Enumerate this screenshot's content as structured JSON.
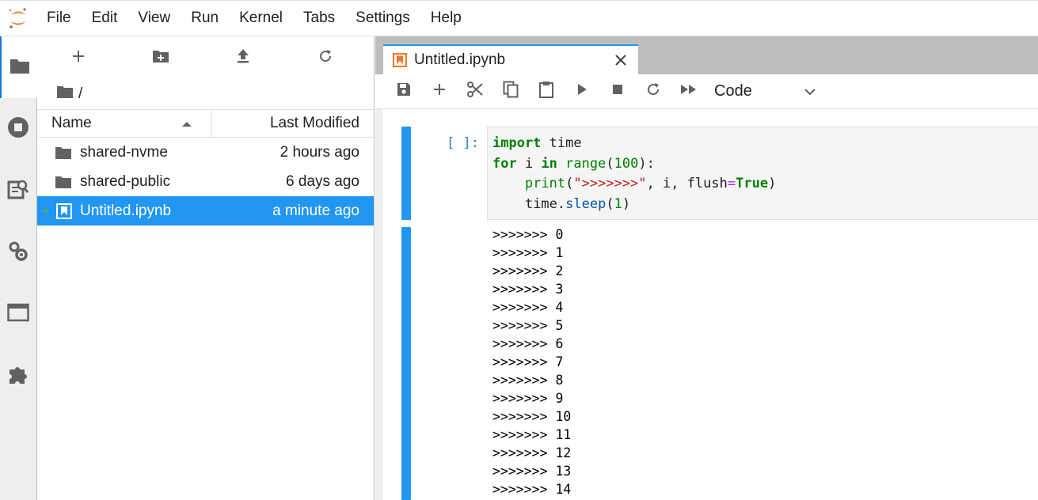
{
  "menubar": {
    "items": [
      "File",
      "Edit",
      "View",
      "Run",
      "Kernel",
      "Tabs",
      "Settings",
      "Help"
    ]
  },
  "leftbar": {
    "icons": [
      "folder-icon",
      "running-icon",
      "command-palette-icon",
      "property-inspector-icon",
      "tabs-icon",
      "extension-icon"
    ]
  },
  "filebrowser": {
    "breadcrumb": "/",
    "col_name": "Name",
    "col_modified": "Last Modified",
    "rows": [
      {
        "name": "shared-nvme",
        "modified": "2 hours ago",
        "type": "folder"
      },
      {
        "name": "shared-public",
        "modified": "6 days ago",
        "type": "folder"
      },
      {
        "name": "Untitled.ipynb",
        "modified": "a minute ago",
        "type": "notebook"
      }
    ]
  },
  "tab": {
    "label": "Untitled.ipynb"
  },
  "notebook_toolbar": {
    "cell_type": "Code"
  },
  "cell": {
    "prompt": "[ ]:",
    "output": [
      ">>>>>>> 0",
      ">>>>>>> 1",
      ">>>>>>> 2",
      ">>>>>>> 3",
      ">>>>>>> 4",
      ">>>>>>> 5",
      ">>>>>>> 6",
      ">>>>>>> 7",
      ">>>>>>> 8",
      ">>>>>>> 9",
      ">>>>>>> 10",
      ">>>>>>> 11",
      ">>>>>>> 12",
      ">>>>>>> 13",
      ">>>>>>> 14"
    ],
    "code": {
      "l1_kw": "import",
      "l1_rest": " time",
      "l2_for": "for",
      "l2_i": " i ",
      "l2_in": "in",
      "l2_sp": " ",
      "l2_range": "range",
      "l2_open": "(",
      "l2_num": "100",
      "l2_close": "):",
      "l3_indent": "    ",
      "l3_print": "print",
      "l3_open": "(",
      "l3_str": "\">>>>>>>\"",
      "l3_mid": ", i, flush",
      "l3_eq": "=",
      "l3_true": "True",
      "l3_close": ")",
      "l4_indent": "    ",
      "l4_time": "time.",
      "l4_sleep": "sleep",
      "l4_open": "(",
      "l4_num": "1",
      "l4_close": ")"
    }
  },
  "colors": {
    "accent": "#2196f3",
    "jupyter_orange": "#f37726"
  }
}
